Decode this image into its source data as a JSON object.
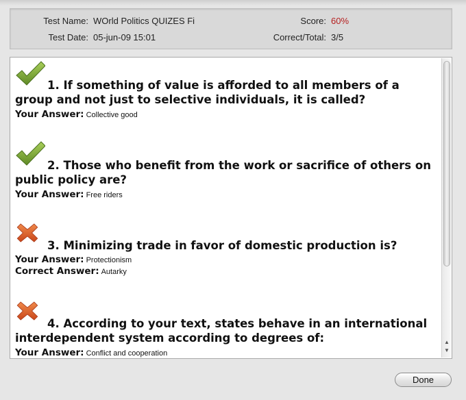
{
  "header": {
    "test_name_label": "Test Name:",
    "test_name_value": "WOrld Politics QUIZES Fi",
    "test_date_label": "Test Date:",
    "test_date_value": "05-jun-09 15:01",
    "score_label": "Score:",
    "score_value": "60%",
    "correct_total_label": "Correct/Total:",
    "correct_total_value": "3/5"
  },
  "answer_labels": {
    "your": "Your Answer:",
    "correct": "Correct Answer:"
  },
  "questions": [
    {
      "status": "correct",
      "icon": "checkmark-icon",
      "text": "1. If something of value is afforded to all members of a group and not just to selective individuals, it is called?",
      "your_answer": "Collective good"
    },
    {
      "status": "correct",
      "icon": "checkmark-icon",
      "text": "2. Those who benefit from the work or sacrifice of others on public policy are?",
      "your_answer": "Free riders"
    },
    {
      "status": "incorrect",
      "icon": "cross-icon",
      "text": "3. Minimizing trade in favor of domestic production is?",
      "your_answer": "Protectionism",
      "correct_answer": "Autarky"
    },
    {
      "status": "incorrect",
      "icon": "cross-icon",
      "text": "4. According to your text, states behave in an international interdependent system according to degrees of:",
      "your_answer": "Conflict and cooperation"
    }
  ],
  "footer": {
    "done_label": "Done"
  },
  "colors": {
    "score": "#b52020",
    "check": "#7aa13a",
    "cross": "#e0622a"
  }
}
